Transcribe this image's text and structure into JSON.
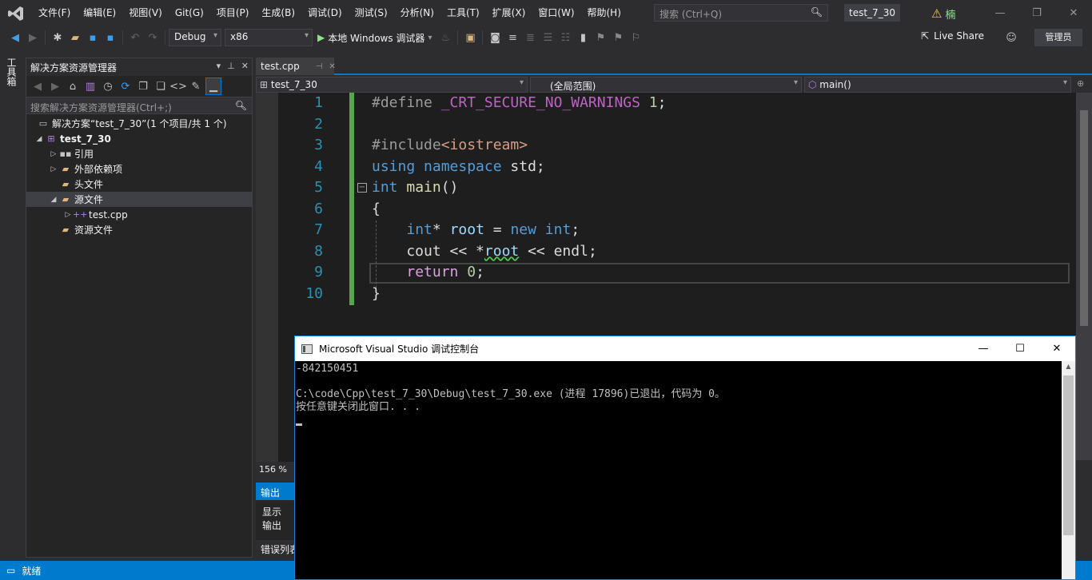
{
  "menubar": {
    "items": [
      "文件(F)",
      "编辑(E)",
      "视图(V)",
      "Git(G)",
      "项目(P)",
      "生成(B)",
      "调试(D)",
      "测试(S)",
      "分析(N)",
      "工具(T)",
      "扩展(X)",
      "窗口(W)",
      "帮助(H)"
    ],
    "search_placeholder": "搜索 (Ctrl+Q)",
    "project_name": "test_7_30",
    "user_char": "楠"
  },
  "toolbar": {
    "config": "Debug",
    "platform": "x86",
    "run_label": "本地 Windows 调试器",
    "liveshare": "Live Share",
    "admin": "管理员"
  },
  "toolbox": {
    "label": "工具箱"
  },
  "solution_explorer": {
    "title": "解决方案资源管理器",
    "search_placeholder": "搜索解决方案资源管理器(Ctrl+;)",
    "solution": "解决方案“test_7_30”(1 个项目/共 1 个)",
    "project": "test_7_30",
    "items": [
      "引用",
      "外部依赖项",
      "头文件",
      "源文件",
      "test.cpp",
      "资源文件"
    ]
  },
  "editor": {
    "tab": "test.cpp",
    "nav_project": "test_7_30",
    "nav_scope": "(全局范围)",
    "nav_func": "main()",
    "line_numbers": [
      "1",
      "2",
      "3",
      "4",
      "5",
      "6",
      "7",
      "8",
      "9",
      "10"
    ],
    "zoom": "156 %"
  },
  "output": {
    "title": "输出",
    "show_label": "显示输出",
    "errors_tab": "错误列表"
  },
  "status": {
    "text": "就绪"
  },
  "console": {
    "title": "Microsoft Visual Studio 调试控制台",
    "lines": [
      "-842150451",
      "",
      "C:\\code\\Cpp\\test_7_30\\Debug\\test_7_30.exe (进程 17896)已退出，代码为 0。",
      "按任意键关闭此窗口. . ."
    ]
  },
  "colors": {
    "accent": "#007acc",
    "keyword": "#569cd6",
    "line_number": "#2b91af",
    "change_bar": "#57a64a"
  }
}
